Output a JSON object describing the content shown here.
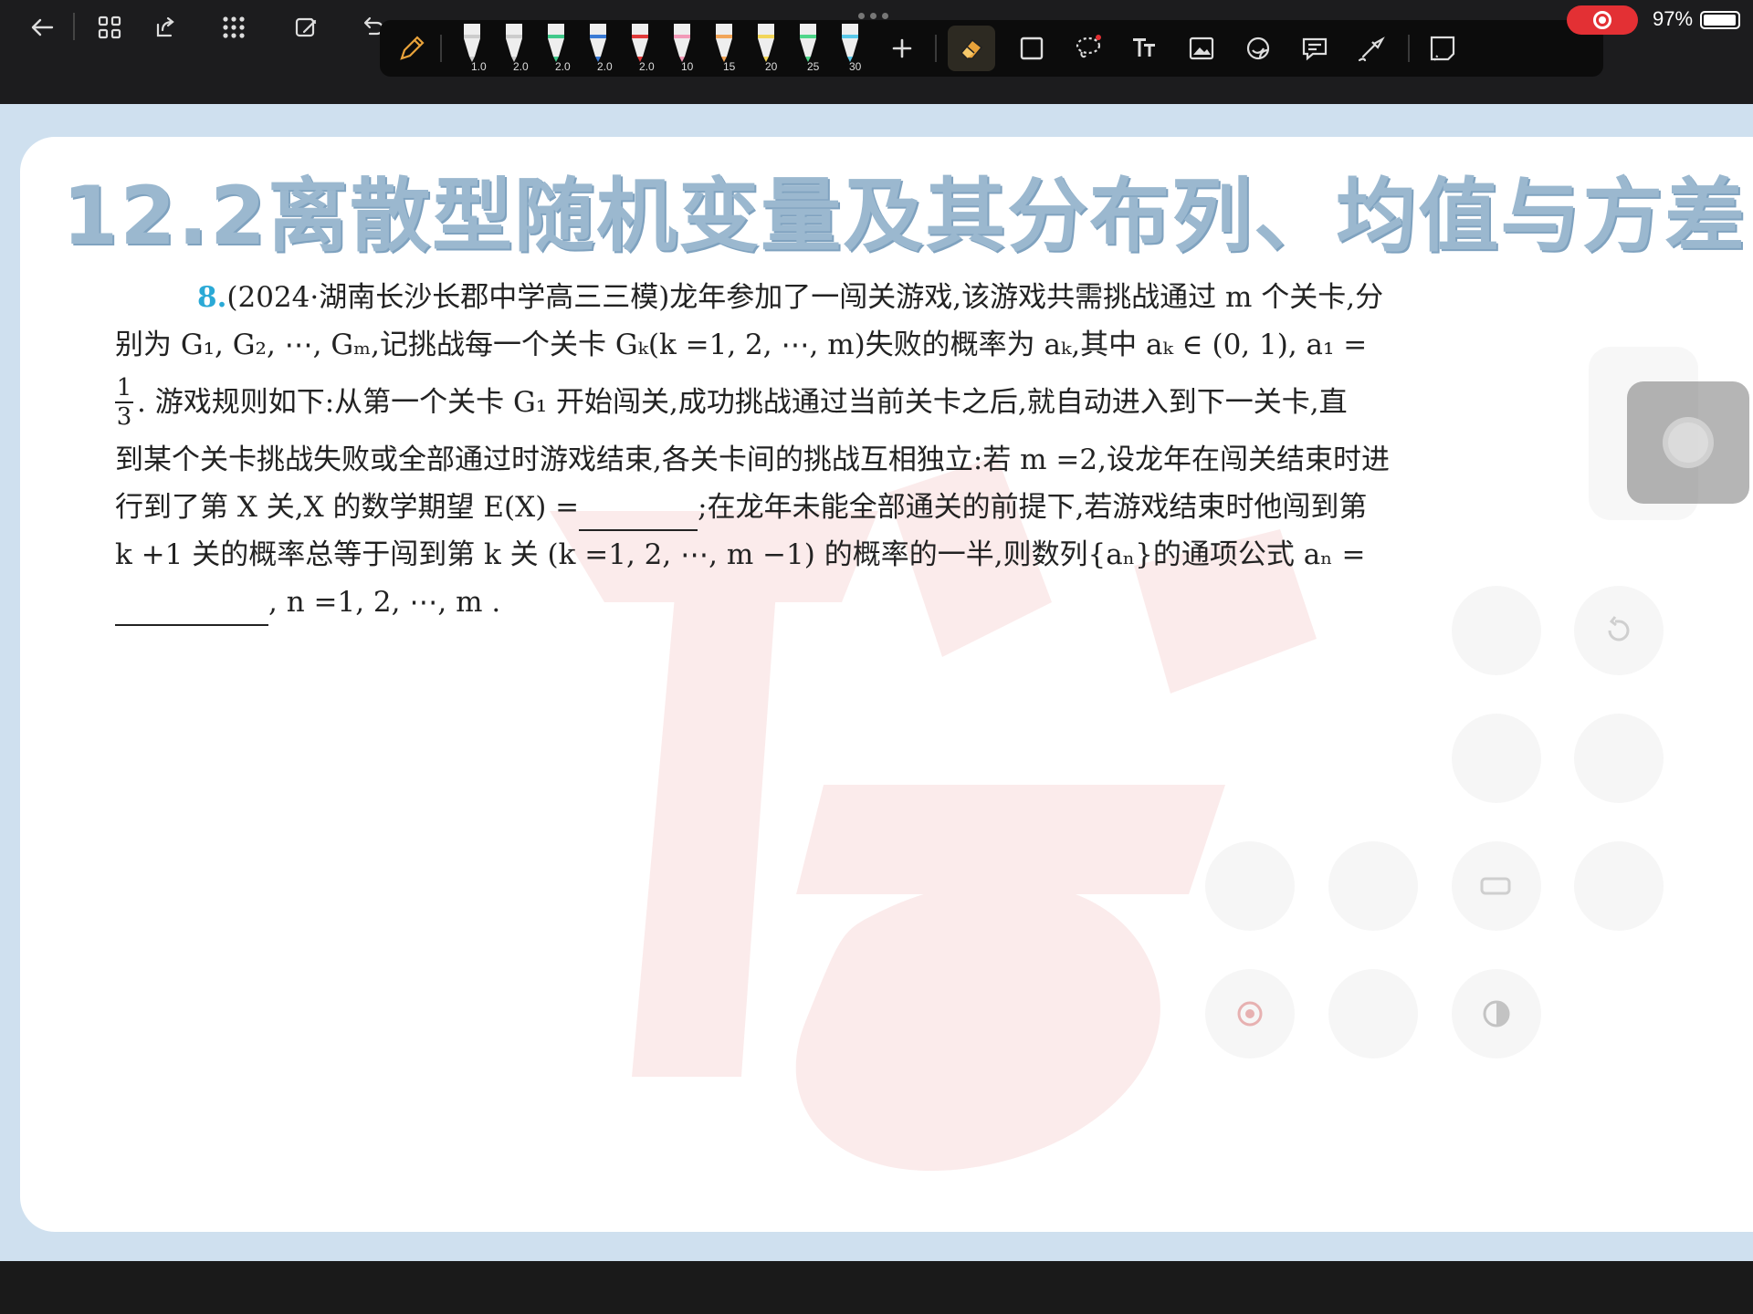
{
  "status": {
    "battery_text": "97%",
    "battery_level": 0.97,
    "recording": true
  },
  "toolbar": {
    "pens": [
      {
        "size": "1.0",
        "color": "#cccccc"
      },
      {
        "size": "2.0",
        "color": "#cccccc"
      },
      {
        "size": "2.0",
        "color": "#41c98b"
      },
      {
        "size": "2.0",
        "color": "#3a7bd5"
      },
      {
        "size": "2.0",
        "color": "#e03a3a"
      },
      {
        "size": "10",
        "color": "#f29ab8"
      },
      {
        "size": "15",
        "color": "#f2a65a"
      },
      {
        "size": "20",
        "color": "#f2d65a"
      },
      {
        "size": "25",
        "color": "#4fd68a"
      },
      {
        "size": "30",
        "color": "#5ac8e8"
      }
    ],
    "active_tool": "eraser",
    "accent_color": "#e8a23a"
  },
  "document": {
    "title": "12.2离散型随机变量及其分布列、均值与方差",
    "question": {
      "number": "8.",
      "line1": "(2024·湖南长沙长郡中学高三三模)龙年参加了一闯关游戏,该游戏共需挑战通过 m 个关卡,分",
      "line2": "别为 G₁, G₂, ⋯, Gₘ,记挑战每一个关卡 Gₖ(k =1, 2, ⋯, m)失败的概率为 aₖ,其中 aₖ ∈ (0, 1), a₁ =",
      "frac_num": "1",
      "frac_den": "3",
      "line3": ". 游戏规则如下:从第一个关卡 G₁ 开始闯关,成功挑战通过当前关卡之后,就自动进入到下一关卡,直",
      "line4": "到某个关卡挑战失败或全部通过时游戏结束,各关卡间的挑战互相独立:若 m =2,设龙年在闯关结束时进",
      "line5a": "行到了第 X 关,X 的数学期望 E(X) =",
      "line5b": ";在龙年未能全部通关的前提下,若游戏结束时他闯到第",
      "line6": "k +1 关的概率总等于闯到第 k 关 (k =1, 2, ⋯, m −1) 的概率的一半,则数列{aₙ}的通项公式 aₙ =",
      "line7": ", n =1, 2, ⋯, m ."
    }
  }
}
